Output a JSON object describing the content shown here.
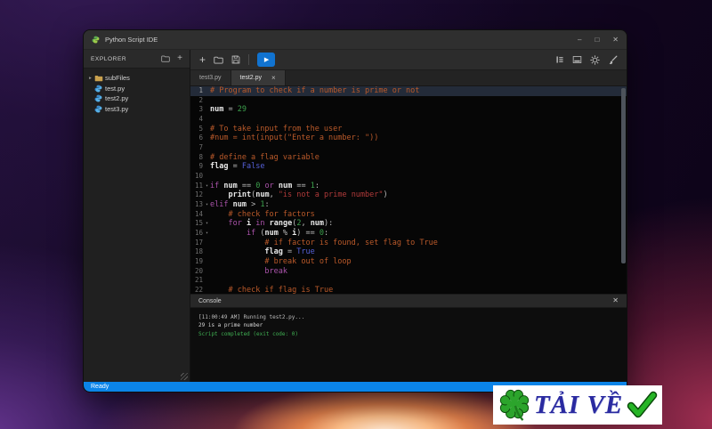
{
  "window": {
    "title": "Python Script IDE",
    "controls": {
      "minimize": "–",
      "maximize": "□",
      "close": "✕"
    }
  },
  "icons": {
    "plus": "+",
    "chevron_right": "▸",
    "fold": "▾",
    "tab_close": "×",
    "console_close": "✕",
    "play": "▶"
  },
  "explorer": {
    "title": "EXPLORER",
    "items": [
      {
        "label": "subFiles",
        "type": "folder"
      },
      {
        "label": "test.py",
        "type": "python"
      },
      {
        "label": "test2.py",
        "type": "python"
      },
      {
        "label": "test3.py",
        "type": "python"
      }
    ]
  },
  "tabs": [
    {
      "label": "test3.py",
      "active": false,
      "closable": false
    },
    {
      "label": "test2.py",
      "active": true,
      "closable": true
    }
  ],
  "editor": {
    "lines": [
      {
        "n": 1,
        "hl": true,
        "segs": [
          [
            "# Program to check if a number is prime or not",
            "c"
          ]
        ]
      },
      {
        "n": 2,
        "segs": []
      },
      {
        "n": 3,
        "segs": [
          [
            "num",
            "v"
          ],
          [
            " = ",
            "p"
          ],
          [
            "29",
            "n"
          ]
        ]
      },
      {
        "n": 4,
        "segs": []
      },
      {
        "n": 5,
        "segs": [
          [
            "# To take input from the user",
            "c"
          ]
        ]
      },
      {
        "n": 6,
        "segs": [
          [
            "#num = int(input(\"Enter a number: \"))",
            "c"
          ]
        ]
      },
      {
        "n": 7,
        "segs": []
      },
      {
        "n": 8,
        "segs": [
          [
            "# define a flag variable",
            "c"
          ]
        ]
      },
      {
        "n": 9,
        "segs": [
          [
            "flag",
            "v"
          ],
          [
            " = ",
            "p"
          ],
          [
            "False",
            "b"
          ]
        ]
      },
      {
        "n": 10,
        "segs": []
      },
      {
        "n": 11,
        "fold": true,
        "segs": [
          [
            "if",
            "k"
          ],
          [
            " ",
            "p"
          ],
          [
            "num",
            "v"
          ],
          [
            " == ",
            "p"
          ],
          [
            "0",
            "n"
          ],
          [
            " ",
            "p"
          ],
          [
            "or",
            "k"
          ],
          [
            " ",
            "p"
          ],
          [
            "num",
            "v"
          ],
          [
            " == ",
            "p"
          ],
          [
            "1",
            "n"
          ],
          [
            ":",
            "p"
          ]
        ]
      },
      {
        "n": 12,
        "segs": [
          [
            "    ",
            "p"
          ],
          [
            "print",
            "v"
          ],
          [
            "(",
            "p"
          ],
          [
            "num",
            "v"
          ],
          [
            ", ",
            "p"
          ],
          [
            "\"is not a prime number\"",
            "s"
          ],
          [
            ")",
            "p"
          ]
        ]
      },
      {
        "n": 13,
        "fold": true,
        "segs": [
          [
            "elif",
            "k"
          ],
          [
            " ",
            "p"
          ],
          [
            "num",
            "v"
          ],
          [
            " > ",
            "p"
          ],
          [
            "1",
            "n"
          ],
          [
            ":",
            "p"
          ]
        ]
      },
      {
        "n": 14,
        "segs": [
          [
            "    ",
            "p"
          ],
          [
            "# check for factors",
            "c"
          ]
        ]
      },
      {
        "n": 15,
        "fold": true,
        "segs": [
          [
            "    ",
            "p"
          ],
          [
            "for",
            "k"
          ],
          [
            " ",
            "p"
          ],
          [
            "i",
            "v"
          ],
          [
            " ",
            "p"
          ],
          [
            "in",
            "k"
          ],
          [
            " ",
            "p"
          ],
          [
            "range",
            "v"
          ],
          [
            "(",
            "p"
          ],
          [
            "2",
            "n"
          ],
          [
            ", ",
            "p"
          ],
          [
            "num",
            "v"
          ],
          [
            "):",
            "p"
          ]
        ]
      },
      {
        "n": 16,
        "fold": true,
        "segs": [
          [
            "        ",
            "p"
          ],
          [
            "if",
            "k"
          ],
          [
            " (",
            "p"
          ],
          [
            "num",
            "v"
          ],
          [
            " % ",
            "p"
          ],
          [
            "i",
            "v"
          ],
          [
            ") == ",
            "p"
          ],
          [
            "0",
            "n"
          ],
          [
            ":",
            "p"
          ]
        ]
      },
      {
        "n": 17,
        "segs": [
          [
            "            ",
            "p"
          ],
          [
            "# if factor is found, set flag to True",
            "c"
          ]
        ]
      },
      {
        "n": 18,
        "segs": [
          [
            "            ",
            "p"
          ],
          [
            "flag",
            "v"
          ],
          [
            " = ",
            "p"
          ],
          [
            "True",
            "b"
          ]
        ]
      },
      {
        "n": 19,
        "segs": [
          [
            "            ",
            "p"
          ],
          [
            "# break out of loop",
            "c"
          ]
        ]
      },
      {
        "n": 20,
        "segs": [
          [
            "            ",
            "p"
          ],
          [
            "break",
            "k"
          ]
        ]
      },
      {
        "n": 21,
        "segs": []
      },
      {
        "n": 22,
        "segs": [
          [
            "    ",
            "p"
          ],
          [
            "# check if flag is True",
            "c"
          ]
        ]
      }
    ]
  },
  "console": {
    "title": "Console",
    "lines": [
      {
        "text": "[11:00:49 AM] Running test2.py...",
        "kind": "log"
      },
      {
        "text": "29 is a prime number",
        "kind": "out"
      },
      {
        "text": "Script completed (exit code: 0)",
        "kind": "success"
      }
    ]
  },
  "statusbar": {
    "text": "Ready"
  },
  "badge": {
    "text": "TẢI VỀ"
  },
  "colors": {
    "statusbar": "#0b84e8",
    "run_button": "#1173d0",
    "comment": "#bb5a2a",
    "keyword": "#ab53ab",
    "boolean": "#5560d6",
    "number": "#3da14d",
    "string": "#b03a3a",
    "success": "#3fae52",
    "badge_text": "#2a2aa0",
    "badge_green": "#2ca42c"
  }
}
